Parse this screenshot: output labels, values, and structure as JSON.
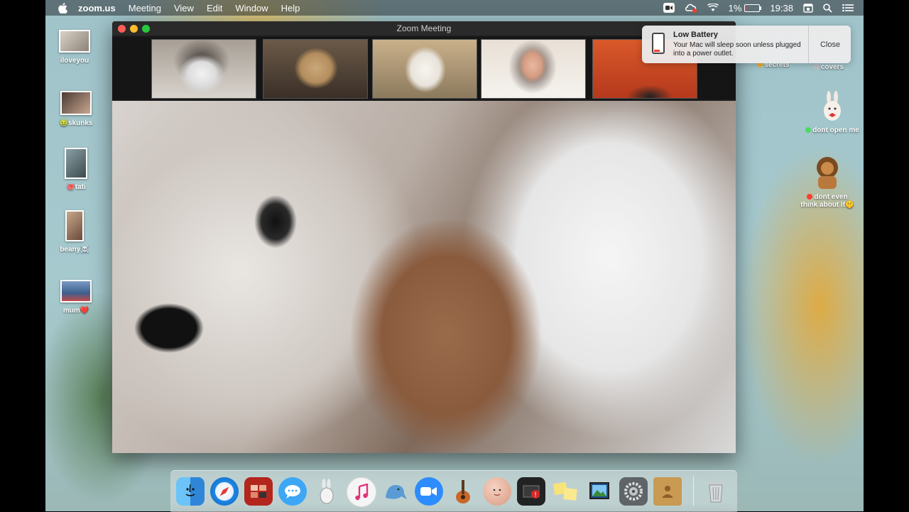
{
  "menubar": {
    "app": "zoom.us",
    "menus": [
      "Meeting",
      "View",
      "Edit",
      "Window",
      "Help"
    ],
    "battery_percent": "1%",
    "battery_level": 0.01,
    "time": "19:38"
  },
  "desktop_left": [
    {
      "label": "iloveyou",
      "tag_color": ""
    },
    {
      "label": "skunks",
      "tag_color": "#5ac84a",
      "tag": "🤢"
    },
    {
      "label": "tati",
      "tag_color": "",
      "tag": "🐙"
    },
    {
      "label": "beany",
      "tag_color": "",
      "tag_after": "☠️"
    },
    {
      "label": "mum",
      "tag_color": "",
      "tag_after": "❤️"
    }
  ],
  "desktop_right": [
    {
      "label": "secrets",
      "tag_color": "#f0b030"
    },
    {
      "label": "covers",
      "tag_color": "#c0c0c0"
    },
    {
      "label": "dont open me",
      "tag_color": "#4cd964"
    },
    {
      "label_line1": "dont even",
      "label_line2": "think about it",
      "tag_after": "🤫",
      "tag_color": "#ff3b30"
    }
  ],
  "zoom": {
    "title": "Zoom Meeting",
    "participants": [
      {
        "name": "husky-video"
      },
      {
        "name": "poodle-video"
      },
      {
        "name": "terrier-video"
      },
      {
        "name": "woman-video"
      },
      {
        "name": "red-room-video"
      }
    ]
  },
  "notification": {
    "title": "Low Battery",
    "body": "Your Mac will sleep soon unless plugged into a power outlet.",
    "close_label": "Close"
  },
  "dock": {
    "apps": [
      {
        "name": "finder",
        "color": "#3aa0f0"
      },
      {
        "name": "safari",
        "color": "#1e88e5"
      },
      {
        "name": "photo-booth",
        "color": "#b3261e"
      },
      {
        "name": "messages",
        "color": "#3da7f5"
      },
      {
        "name": "rabbit-app",
        "color": "#9aa6aa"
      },
      {
        "name": "itunes",
        "color": "#f5f5f5"
      },
      {
        "name": "seal-app",
        "color": "#5b9bd5"
      },
      {
        "name": "zoom",
        "color": "#2d8cff"
      },
      {
        "name": "garageband",
        "color": "#5a3a1e"
      },
      {
        "name": "face-app",
        "color": "#e9b8a0"
      },
      {
        "name": "photo-app",
        "color": "#222222"
      },
      {
        "name": "stickies",
        "color": "#f8e27a"
      },
      {
        "name": "preview",
        "color": "#3a7bd5"
      },
      {
        "name": "system-preferences",
        "color": "#6f7478"
      },
      {
        "name": "contacts",
        "color": "#c99a52"
      },
      {
        "name": "trash",
        "color": "#9aa0a3"
      }
    ]
  }
}
